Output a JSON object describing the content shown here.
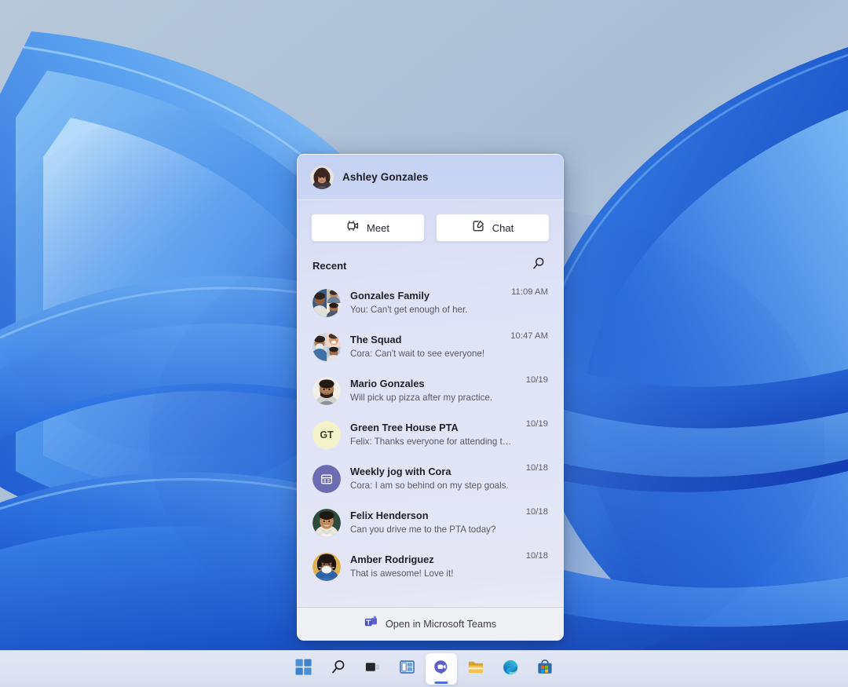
{
  "desktop": {
    "wallpaper_name": "windows-11-bloom-wallpaper",
    "wallpaper_colors": {
      "sky": "#b0c2d6",
      "petal_light": "#74b3ef",
      "petal_mid": "#3f8ce8",
      "petal_deep": "#1a5fe0",
      "petal_dark": "#1247c4"
    }
  },
  "flyout": {
    "header": {
      "profile_name": "Ashley Gonzales",
      "avatar_name": "profile-avatar"
    },
    "actions": [
      {
        "label": "Meet",
        "icon": "video-camera-icon"
      },
      {
        "label": "Chat",
        "icon": "compose-chat-icon"
      }
    ],
    "recent": {
      "label": "Recent",
      "search_icon": "search-icon"
    },
    "chats": [
      {
        "title": "Gonzales Family",
        "preview": "You: Can't get enough of her.",
        "time": "11:09 AM",
        "avatar_type": "group-collage"
      },
      {
        "title": "The Squad",
        "preview": "Cora: Can't wait to see everyone!",
        "time": "10:47 AM",
        "avatar_type": "group-collage"
      },
      {
        "title": "Mario Gonzales",
        "preview": "Will pick up pizza after my practice.",
        "time": "10/19",
        "avatar_type": "photo"
      },
      {
        "title": "Green Tree House PTA",
        "preview": "Felix: Thanks everyone for attending today.",
        "time": "10/19",
        "avatar_type": "initials",
        "initials": "GT",
        "initials_bg": "#f4f2c8"
      },
      {
        "title": "Weekly jog with Cora",
        "preview": "Cora: I am so behind on my step goals.",
        "time": "10/18",
        "avatar_type": "icon",
        "icon": "calendar-icon",
        "icon_bg": "#6b6cb2"
      },
      {
        "title": "Felix Henderson",
        "preview": "Can you drive me to the PTA today?",
        "time": "10/18",
        "avatar_type": "photo"
      },
      {
        "title": "Amber Rodriguez",
        "preview": "That is awesome! Love it!",
        "time": "10/18",
        "avatar_type": "photo"
      }
    ],
    "footer": {
      "label": "Open in Microsoft Teams",
      "icon": "microsoft-teams-icon"
    },
    "colors": {
      "panel_top": "#c8d4f2",
      "panel_bottom": "#eceef4",
      "footer_bg": "#eff0f4",
      "button_bg": "#ffffff"
    }
  },
  "taskbar": {
    "items": [
      {
        "name": "start-icon",
        "label": "Start",
        "active": false
      },
      {
        "name": "search-icon",
        "label": "Search",
        "active": false
      },
      {
        "name": "task-view-icon",
        "label": "Task View",
        "active": false
      },
      {
        "name": "widgets-icon",
        "label": "Widgets",
        "active": false
      },
      {
        "name": "chat-icon",
        "label": "Chat",
        "active": true
      },
      {
        "name": "file-explorer-icon",
        "label": "File Explorer",
        "active": false
      },
      {
        "name": "edge-icon",
        "label": "Microsoft Edge",
        "active": false
      },
      {
        "name": "store-icon",
        "label": "Microsoft Store",
        "active": false
      }
    ],
    "accent_color": "#4b6fd4",
    "background": "#dde3f2"
  }
}
